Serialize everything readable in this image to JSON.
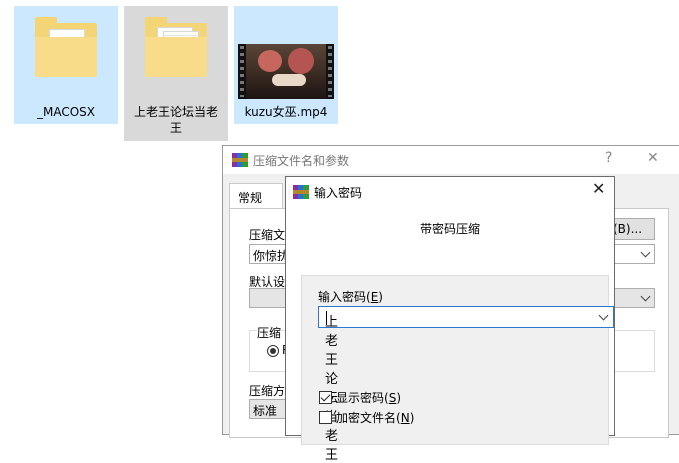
{
  "desktop": {
    "icons": [
      {
        "name": "_MACOSX"
      },
      {
        "name_line1": "上老王论坛当老",
        "name_line2": "王"
      },
      {
        "name": "kuzu女巫.mp4"
      }
    ]
  },
  "archive_dialog": {
    "title": "压缩文件名和参数",
    "help_glyph": "?",
    "close_glyph": "✕",
    "tab_general": "常规",
    "archive_name_label": "压缩文",
    "archive_name_value": "你惊扰",
    "browse_button": "(B)...",
    "default_profile_label": "默认设",
    "update_group_label": "压缩",
    "radio_text": "R",
    "method_label": "压缩方",
    "method_value": "标准"
  },
  "password_dialog": {
    "title": "输入密码",
    "close_glyph": "✕",
    "heading": "带密码压缩",
    "password_label": "输入密码",
    "password_label_key": "E",
    "password_value": "上老王论坛当老王",
    "show_password_label": "显示密码",
    "show_password_key": "S",
    "show_password_checked": true,
    "encrypt_names_label": "加密文件名",
    "encrypt_names_key": "N",
    "encrypt_names_checked": false
  }
}
